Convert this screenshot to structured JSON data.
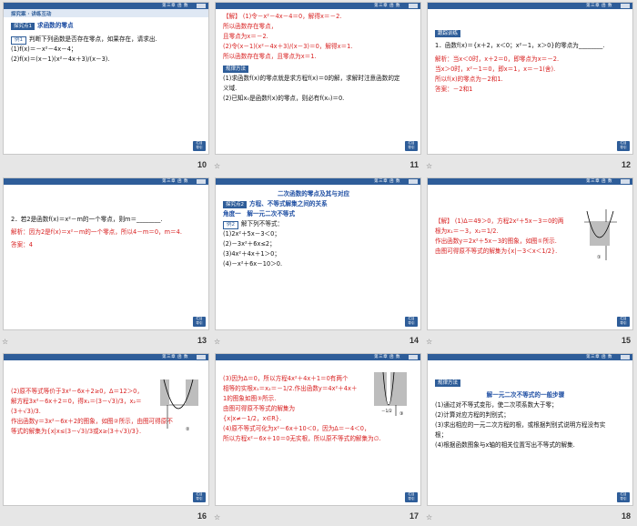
{
  "topbar_tag": "第三章 函 数",
  "corner_btn": [
    "栏目",
    "导引"
  ],
  "slides": [
    {
      "num": "10",
      "header": "探究案 · 讲练互动",
      "label": "探究点1",
      "title": "求函数的零点",
      "example": "例1",
      "lines": [
        "判断下列函数是否存在零点，如果存在，请求出.",
        "(1)f(x)＝－x²－4x－4；",
        "(2)f(x)＝(x－1)(x²－4x＋3)/(x－3)."
      ]
    },
    {
      "num": "11",
      "lines_red": [
        "【解】 (1)令－x²－4x－4＝0，解得x＝－2.",
        "所以函数存在零点，",
        "且零点为x＝－2.",
        "(2)令(x－1)(x²－4x＋3)/(x－3)＝0，解得x＝1.",
        "所以函数存在零点，且零点为x＝1."
      ],
      "method_label": "规律方法",
      "method": [
        "(1)求函数f(x)的零点就是求方程f(x)＝0的解，求解时注意函数的定义域.",
        "(2)已知x₀是函数f(x)的零点，则必有f(x₀)＝0."
      ]
    },
    {
      "num": "12",
      "label": "跟踪训练",
      "q": "1．函数f(x)＝{x＋2，x＜0；x²－1，x＞0}的零点为________.",
      "ans": [
        "解析：当x＜0时，x＋2＝0，即零点为x＝－2.",
        "当x＞0时，x²－1＝0，即x＝1，x＝－1(舍).",
        "所以f(x)的零点为－2和1.",
        "答案：－2和1"
      ]
    },
    {
      "num": "13",
      "q": "2．若2是函数f(x)＝x²－m的一个零点，则m＝________.",
      "ans": [
        "解析：因为2是f(x)＝x²－m的一个零点，所以4－m＝0，m＝4.",
        "答案：4"
      ]
    },
    {
      "num": "14",
      "title1": "二次函数的零点及其与对应",
      "label": "探究点2",
      "title2": "方程、不等式解集之间的关系",
      "sub": "角度一　解一元二次不等式",
      "example": "例2",
      "lines": [
        "解下列不等式：",
        "(1)2x²＋5x－3＜0；",
        "(2)－3x²＋6x≤2；",
        "(3)4x²＋4x＋1＞0；",
        "(4)－x²＋6x－10＞0."
      ]
    },
    {
      "num": "15",
      "lines": [
        "【解】 (1)Δ＝49＞0，方程2x²＋5x－3＝0的两",
        "根为x₁＝－3，x₂＝1/2.",
        "作出函数y＝2x²＋5x－3的图象，如图①所示.",
        "由图可得原不等式的解集为{x|－3＜x＜1/2}."
      ],
      "graph_label": "①"
    },
    {
      "num": "16",
      "lines": [
        "(2)原不等式等价于3x²－6x＋2≥0，Δ＝12＞0，",
        "解方程3x²－6x＋2＝0，得x₁＝(3－√3)/3，x₂＝",
        "(3＋√3)/3.",
        "作出函数y＝3x²－6x＋2的图象，如图②所示，由图可得原不",
        "等式的解集为{x|x≤(3－√3)/3或x≥(3＋√3)/3}."
      ],
      "graph_label": "②"
    },
    {
      "num": "17",
      "lines": [
        "(3)因为Δ＝0，所以方程4x²＋4x＋1＝0有两个",
        "相等的实根x₁＝x₂＝－1/2.作出函数y＝4x²＋4x＋",
        "1的图象如图③所示.",
        "由图可得原不等式的解集为",
        "{x|x≠－1/2，x∈R}.",
        "(4)原不等式可化为x²－6x＋10＜0，因为Δ＝－4＜0，",
        "所以方程x²－6x＋10＝0无实根，所以原不等式的解集为∅."
      ],
      "graph_label": "③",
      "axis_label": "－1/2"
    },
    {
      "num": "18",
      "label": "规律方法",
      "title": "解一元二次不等式的一般步骤",
      "lines": [
        "(1)通过对不等式变形，使二次项系数大于零；",
        "(2)计算对应方程的判别式；",
        "(3)求出相应的一元二次方程的根，或根据判别式说明方程没有实根；",
        "(4)根据函数图象与x轴的相关位置写出不等式的解集."
      ]
    }
  ]
}
